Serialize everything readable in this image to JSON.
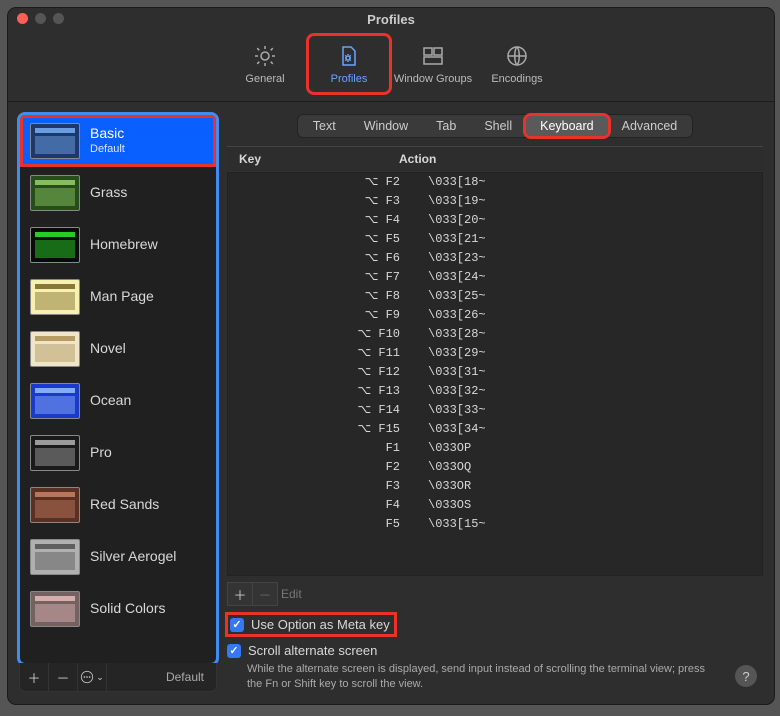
{
  "window": {
    "title": "Profiles"
  },
  "toolbar": [
    {
      "id": "general",
      "label": "General",
      "active": false
    },
    {
      "id": "profiles",
      "label": "Profiles",
      "active": true
    },
    {
      "id": "windowgroups",
      "label": "Window Groups",
      "active": false
    },
    {
      "id": "encodings",
      "label": "Encodings",
      "active": false
    }
  ],
  "sidebar": {
    "profiles": [
      {
        "name": "Basic",
        "sub": "Default",
        "thumb": "th-basic",
        "selected": true
      },
      {
        "name": "Grass",
        "sub": "",
        "thumb": "th-grass",
        "selected": false
      },
      {
        "name": "Homebrew",
        "sub": "",
        "thumb": "th-homebrew",
        "selected": false
      },
      {
        "name": "Man Page",
        "sub": "",
        "thumb": "th-manpage",
        "selected": false
      },
      {
        "name": "Novel",
        "sub": "",
        "thumb": "th-novel",
        "selected": false
      },
      {
        "name": "Ocean",
        "sub": "",
        "thumb": "th-ocean",
        "selected": false
      },
      {
        "name": "Pro",
        "sub": "",
        "thumb": "th-pro",
        "selected": false
      },
      {
        "name": "Red Sands",
        "sub": "",
        "thumb": "th-redsands",
        "selected": false
      },
      {
        "name": "Silver Aerogel",
        "sub": "",
        "thumb": "th-silver",
        "selected": false
      },
      {
        "name": "Solid Colors",
        "sub": "",
        "thumb": "th-solid",
        "selected": false
      }
    ],
    "footer_default": "Default"
  },
  "tabs": [
    {
      "label": "Text",
      "active": false
    },
    {
      "label": "Window",
      "active": false
    },
    {
      "label": "Tab",
      "active": false
    },
    {
      "label": "Shell",
      "active": false
    },
    {
      "label": "Keyboard",
      "active": true
    },
    {
      "label": "Advanced",
      "active": false
    }
  ],
  "table": {
    "columns": {
      "key": "Key",
      "action": "Action"
    },
    "rows": [
      {
        "key": "⌥ F2",
        "action": "\\033[18~"
      },
      {
        "key": "⌥ F3",
        "action": "\\033[19~"
      },
      {
        "key": "⌥ F4",
        "action": "\\033[20~"
      },
      {
        "key": "⌥ F5",
        "action": "\\033[21~"
      },
      {
        "key": "⌥ F6",
        "action": "\\033[23~"
      },
      {
        "key": "⌥ F7",
        "action": "\\033[24~"
      },
      {
        "key": "⌥ F8",
        "action": "\\033[25~"
      },
      {
        "key": "⌥ F9",
        "action": "\\033[26~"
      },
      {
        "key": "⌥ F10",
        "action": "\\033[28~"
      },
      {
        "key": "⌥ F11",
        "action": "\\033[29~"
      },
      {
        "key": "⌥ F12",
        "action": "\\033[31~"
      },
      {
        "key": "⌥ F13",
        "action": "\\033[32~"
      },
      {
        "key": "⌥ F14",
        "action": "\\033[33~"
      },
      {
        "key": "⌥ F15",
        "action": "\\033[34~"
      },
      {
        "key": "F1",
        "action": "\\033OP"
      },
      {
        "key": "F2",
        "action": "\\033OQ"
      },
      {
        "key": "F3",
        "action": "\\033OR"
      },
      {
        "key": "F4",
        "action": "\\033OS"
      },
      {
        "key": "F5",
        "action": "\\033[15~"
      }
    ],
    "edit_label": "Edit"
  },
  "options": {
    "meta": {
      "label": "Use Option as Meta key",
      "checked": true
    },
    "scroll": {
      "label": "Scroll alternate screen",
      "checked": true
    },
    "hint": "While the alternate screen is displayed, send input instead of scrolling the terminal view; press the Fn or Shift key to scroll the view."
  }
}
